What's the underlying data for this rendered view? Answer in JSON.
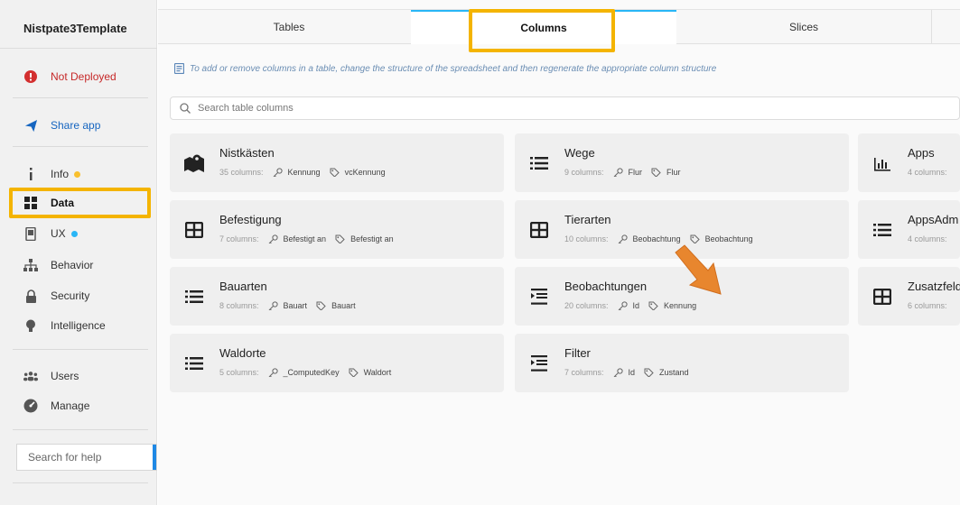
{
  "sidebar": {
    "app_name": "Nistpate3Template",
    "not_deployed": "Not Deployed",
    "share_app": "Share app",
    "items": [
      {
        "label": "Info"
      },
      {
        "label": "Data"
      },
      {
        "label": "UX"
      },
      {
        "label": "Behavior"
      },
      {
        "label": "Security"
      },
      {
        "label": "Intelligence"
      }
    ],
    "users": "Users",
    "manage": "Manage",
    "search_help": "Search for help"
  },
  "tabs": [
    "Tables",
    "Columns",
    "Slices"
  ],
  "active_tab": "Columns",
  "info_text": "To add or remove columns in a table, change the structure of the spreadsheet and then regenerate the appropriate column structure",
  "search_placeholder": "Search table columns",
  "cards": [
    {
      "name": "Nistkästen",
      "count": "35 columns:",
      "key": "Kennung",
      "label": "vcKennung",
      "icon": "map-icon"
    },
    {
      "name": "Wege",
      "count": "9 columns:",
      "key": "Flur",
      "label": "Flur",
      "icon": "list-icon"
    },
    {
      "name": "Apps",
      "count": "4 columns:",
      "key": "",
      "label": "",
      "icon": "chart-icon"
    },
    {
      "name": "Befestigung",
      "count": "7 columns:",
      "key": "Befestigt an",
      "label": "Befestigt an",
      "icon": "table-icon"
    },
    {
      "name": "Tierarten",
      "count": "10 columns:",
      "key": "Beobachtung",
      "label": "Beobachtung",
      "icon": "table-icon"
    },
    {
      "name": "AppsAdm",
      "count": "4 columns:",
      "key": "",
      "label": "",
      "icon": "list-icon"
    },
    {
      "name": "Bauarten",
      "count": "8 columns:",
      "key": "Bauart",
      "label": "Bauart",
      "icon": "list-icon"
    },
    {
      "name": "Beobachtungen",
      "count": "20 columns:",
      "key": "Id",
      "label": "Kennung",
      "icon": "deck-icon"
    },
    {
      "name": "Zusatzfeld",
      "count": "6 columns:",
      "key": "",
      "label": "",
      "icon": "table-icon"
    },
    {
      "name": "Waldorte",
      "count": "5 columns:",
      "key": "_ComputedKey",
      "label": "Waldort",
      "icon": "list-icon"
    },
    {
      "name": "Filter",
      "count": "7 columns:",
      "key": "Id",
      "label": "Zustand",
      "icon": "deck-icon"
    }
  ],
  "colors": {
    "highlight": "#f4b400",
    "arrow": "#e8862e",
    "active_tab_border": "#29b6f6",
    "not_deployed": "#c62828",
    "share": "#1565c0"
  }
}
